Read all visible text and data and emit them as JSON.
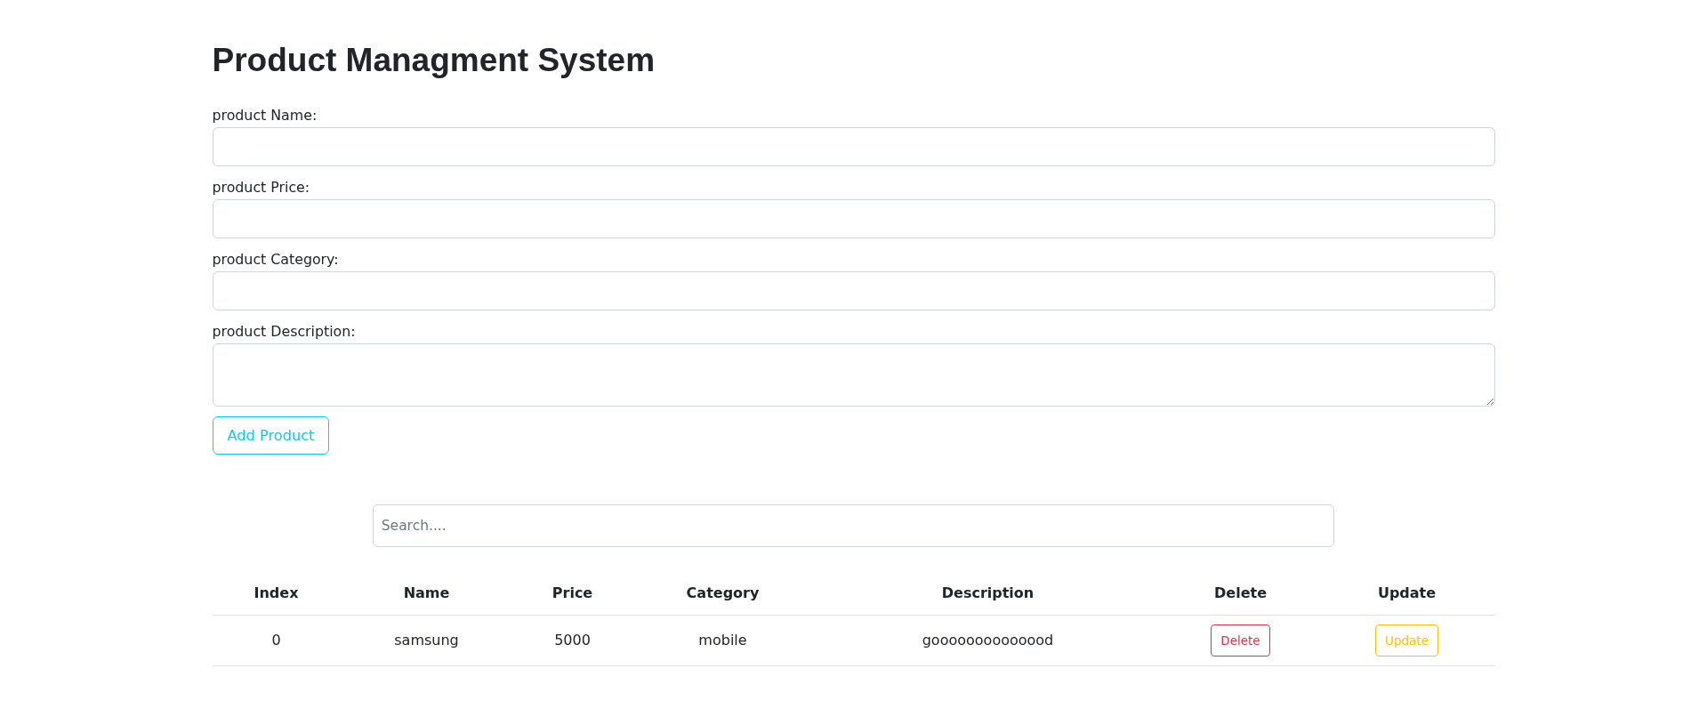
{
  "title": "Product Managment System",
  "form": {
    "fields": [
      {
        "label": "product Name:",
        "kind": "input"
      },
      {
        "label": "product Price:",
        "kind": "input"
      },
      {
        "label": "product Category:",
        "kind": "input"
      },
      {
        "label": "product Description:",
        "kind": "textarea"
      }
    ],
    "submit_button": "Add Product"
  },
  "search": {
    "placeholder": "Search...."
  },
  "table": {
    "columns": [
      "Index",
      "Name",
      "Price",
      "Category",
      "Description",
      "Delete",
      "Update"
    ],
    "rows": [
      {
        "cells": [
          "0",
          "samsung",
          "5000",
          "mobile",
          "goooooooooooood"
        ],
        "actions": [
          {
            "kind": "delete",
            "label": "Delete"
          },
          {
            "kind": "update",
            "label": "Update"
          }
        ]
      }
    ]
  }
}
